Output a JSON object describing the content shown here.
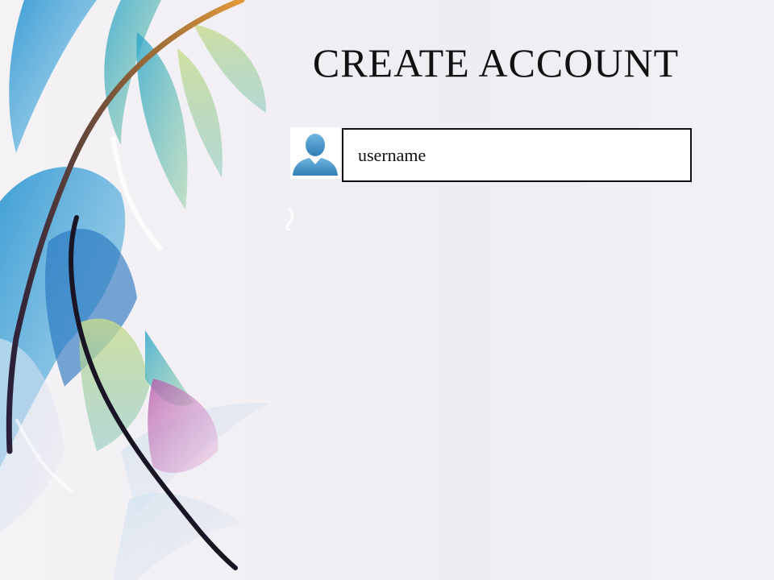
{
  "page": {
    "title": "CREATE ACCOUNT"
  },
  "form": {
    "username": {
      "placeholder": "username",
      "value": "",
      "icon": "user-icon"
    }
  },
  "colors": {
    "background": "#f1eff3",
    "text": "#111111",
    "field_border": "#111111",
    "icon_blue": "#3d8fc4"
  }
}
